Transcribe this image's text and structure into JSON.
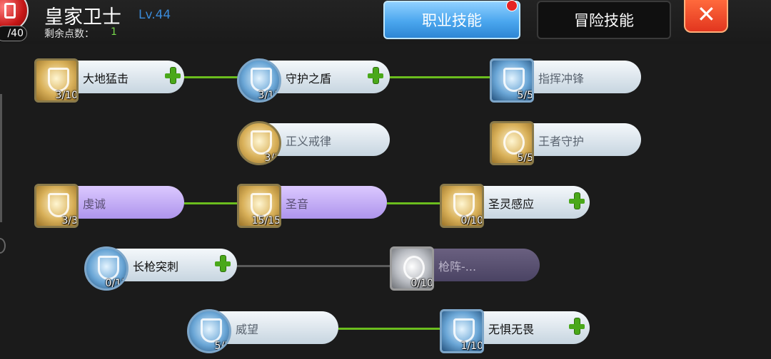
{
  "header": {
    "title": "皇家卫士",
    "level": "Lv.44",
    "avatar_level": "/40",
    "points_label": "剩余点数：",
    "points_value": "1"
  },
  "tabs": [
    {
      "label": "职业技能",
      "active": true,
      "notification": true
    },
    {
      "label": "冒险技能",
      "active": false
    }
  ],
  "close_label": "✕",
  "skills": [
    {
      "name": "大地猛击",
      "level": "3/10",
      "style": "light",
      "plus": true,
      "icon": "shield-burst-icon",
      "frame": "gold"
    },
    {
      "name": "守护之盾",
      "level": "3/15",
      "style": "light",
      "plus": true,
      "icon": "guardian-shield-icon",
      "frame": "blue"
    },
    {
      "name": "指挥冲锋",
      "level": "5/5",
      "style": "light-muted",
      "plus": false,
      "icon": "command-charge-icon",
      "frame": "blue"
    },
    {
      "name": "正义戒律",
      "level": "3/3",
      "style": "light-muted",
      "plus": false,
      "icon": "justice-icon",
      "frame": "gold"
    },
    {
      "name": "王者守护",
      "level": "5/5",
      "style": "light-muted",
      "plus": false,
      "icon": "king-guard-icon",
      "frame": "gold"
    },
    {
      "name": "虔诚",
      "level": "3/3",
      "style": "purple",
      "plus": false,
      "icon": "piety-shield-icon",
      "frame": "gold"
    },
    {
      "name": "圣音",
      "level": "15/15",
      "style": "purple",
      "plus": false,
      "icon": "holy-voice-icon",
      "frame": "gold"
    },
    {
      "name": "圣灵感应",
      "level": "0/10",
      "style": "light",
      "plus": true,
      "icon": "holy-spirit-icon",
      "frame": "gold"
    },
    {
      "name": "长枪突刺",
      "level": "0/15",
      "style": "light",
      "plus": true,
      "icon": "spear-thrust-icon",
      "frame": "blue"
    },
    {
      "name": "枪阵-...",
      "level": "0/10",
      "style": "dark",
      "plus": false,
      "icon": "spear-array-icon",
      "frame": "grey"
    },
    {
      "name": "威望",
      "level": "5/5",
      "style": "light-muted",
      "plus": false,
      "icon": "prestige-fist-icon",
      "frame": "blue"
    },
    {
      "name": "无惧无畏",
      "level": "1/10",
      "style": "light",
      "plus": true,
      "icon": "fearless-icon",
      "frame": "blue"
    }
  ],
  "colors": {
    "tab_active": "#4aa6ee",
    "connector_active": "#6bbd1e",
    "plus": "#4aa81a",
    "points": "#76d84a",
    "level_text": "#3a8ad8"
  }
}
